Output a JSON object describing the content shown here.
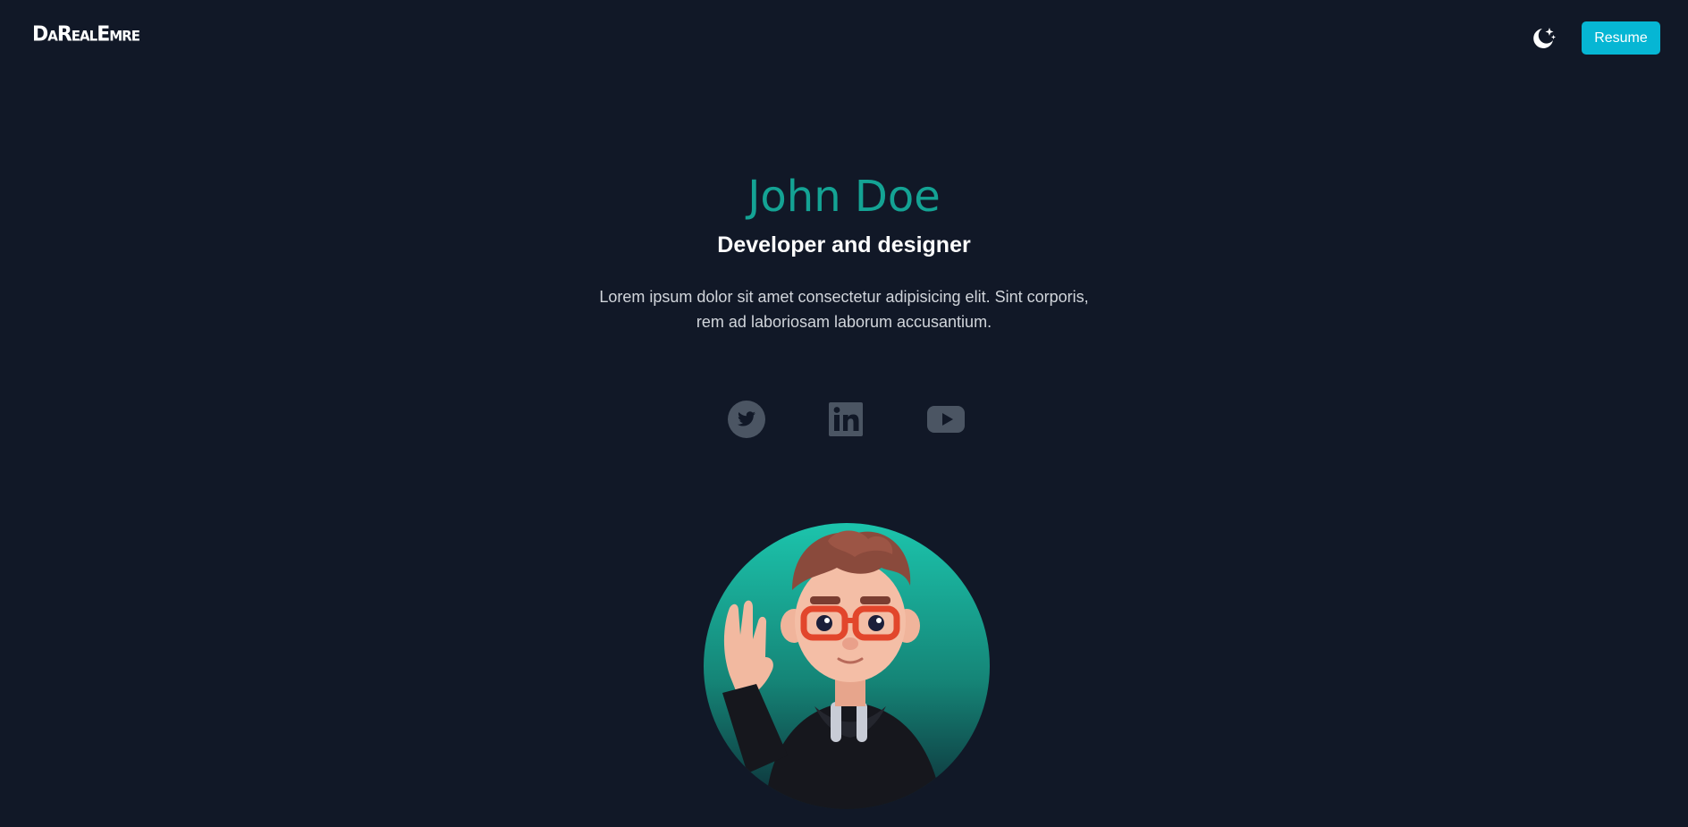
{
  "header": {
    "logo_text": "DaRealEmre",
    "theme_toggle_icon": "moon-stars-icon",
    "resume_label": "Resume"
  },
  "hero": {
    "name": "John Doe",
    "title": "Developer and designer",
    "description": "Lorem ipsum dolor sit amet consectetur adipisicing elit. Sint corporis, rem ad laboriosam laborum accusantium."
  },
  "socials": [
    {
      "icon": "twitter-icon"
    },
    {
      "icon": "linkedin-icon"
    },
    {
      "icon": "youtube-icon"
    }
  ],
  "colors": {
    "background": "#111827",
    "accent": "#14a394",
    "button": "#06b6d4",
    "social_icon": "#4b5563"
  }
}
